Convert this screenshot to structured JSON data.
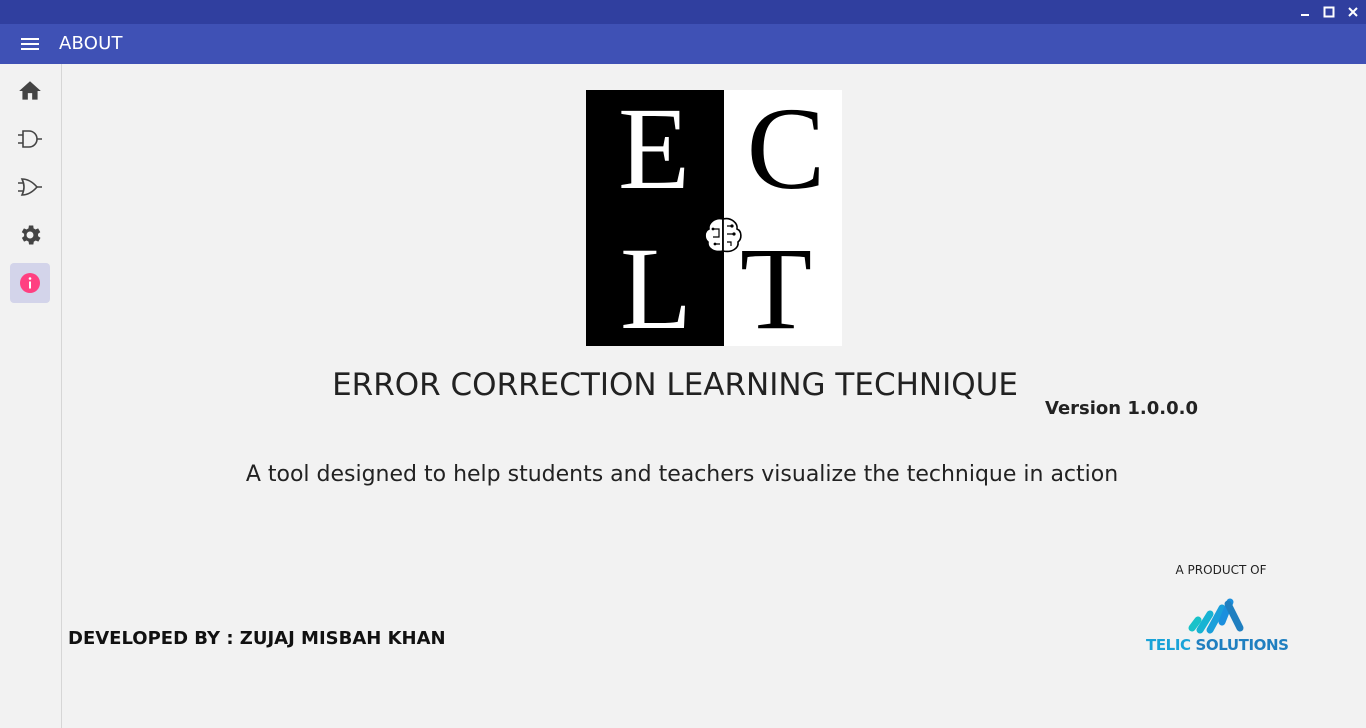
{
  "window": {
    "controls": [
      {
        "name": "minimize",
        "icon": "minimize-icon"
      },
      {
        "name": "maximize",
        "icon": "maximize-icon"
      },
      {
        "name": "close",
        "icon": "close-icon"
      }
    ]
  },
  "appbar": {
    "title": "ABOUT",
    "menu_icon": "hamburger-menu-icon"
  },
  "sidebar": {
    "items": [
      {
        "name": "home",
        "icon": "home-icon",
        "active": false
      },
      {
        "name": "and-gate",
        "icon": "and-gate-icon",
        "active": false
      },
      {
        "name": "or-gate",
        "icon": "or-gate-icon",
        "active": false
      },
      {
        "name": "settings",
        "icon": "gear-icon",
        "active": false
      },
      {
        "name": "about",
        "icon": "info-icon",
        "active": true
      }
    ]
  },
  "logo": {
    "letters": [
      "E",
      "C",
      "L",
      "T"
    ],
    "icon": "brain-circuit-icon"
  },
  "about": {
    "app_name": "ERROR CORRECTION LEARNING TECHNIQUE",
    "version": "Version 1.0.0.0",
    "tagline": "A tool designed to help students and teachers visualize the technique in action",
    "developer": "DEVELOPED BY : ZUJAJ MISBAH KHAN",
    "product_of": "A PRODUCT OF",
    "company_name_part1": "TELIC",
    "company_name_part2": " SOLUTIONS"
  },
  "colors": {
    "titlebar": "#303f9f",
    "appbar": "#3f51b5",
    "active_nav": "#d3d4ea",
    "info_icon": "#ff4081",
    "company_blue": "#1aa3d8"
  }
}
